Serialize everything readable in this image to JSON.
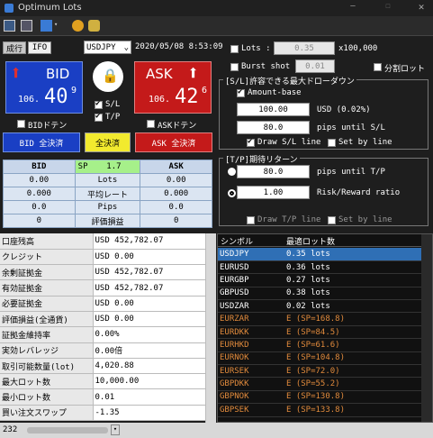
{
  "window": {
    "title": "Optimum Lots"
  },
  "toolbar": {
    "icons": [
      "window-icon",
      "list-icon",
      "grid-icon",
      "person-icon",
      "tools-icon"
    ]
  },
  "mode_tabs": {
    "market": "成行",
    "ifo": "IFO"
  },
  "symbol": {
    "selected": "USDJPY"
  },
  "datetime": "2020/05/08 8:53:09",
  "bid": {
    "label": "BID",
    "price_prefix": "106.",
    "price_big": "40",
    "price_small": "9",
    "color": "#1a3fc4"
  },
  "ask": {
    "label": "ASK",
    "price_prefix": "106.",
    "price_big": "42",
    "price_small": "6",
    "color": "#c41a1a"
  },
  "lock_icon": "lock-icon",
  "sl_label": "S/L",
  "tp_label": "T/P",
  "bid_doten": "BIDドテン",
  "ask_doten": "ASKドテン",
  "close_buttons": {
    "bid": "BID 全決済",
    "all": "全決済",
    "ask": "ASK 全決済"
  },
  "position_grid": {
    "header": {
      "bid": "BID",
      "sp_label": "SP",
      "sp_value": "1.7",
      "ask": "ASK"
    },
    "rows": [
      {
        "bid": "0.00",
        "label": "Lots",
        "ask": "0.00"
      },
      {
        "bid": "0.000",
        "label": "平均レート",
        "ask": "0.000"
      },
      {
        "bid": "0.0",
        "label": "Pips",
        "ask": "0.0"
      },
      {
        "bid": "0",
        "label": "評価損益",
        "ask": "0"
      }
    ]
  },
  "lots_panel": {
    "lots_label": "Lots :",
    "lots_value": "0.35",
    "lots_unit": "x100,000",
    "burst_label": "Burst shot :",
    "burst_value": "0.01",
    "split_label": "分割ロット"
  },
  "sl_panel": {
    "title": "[S/L]許容できる最大ドローダウン",
    "amount_base": "Amount-base",
    "amount_value": "100.00",
    "amount_unit": "USD (0.02%)",
    "pips_value": "80.0",
    "pips_unit": "pips until S/L",
    "draw_sl": "Draw S/L line",
    "set_by_line": "Set by line"
  },
  "tp_panel": {
    "title": "[T/P]期待リターン",
    "pips_value": "80.0",
    "pips_unit": "pips until T/P",
    "ratio_value": "1.00",
    "ratio_unit": "Risk/Reward ratio",
    "draw_tp": "Draw T/P line",
    "set_by_line": "Set by line"
  },
  "account": [
    {
      "k": "口座残高",
      "v": "USD 452,782.07"
    },
    {
      "k": "クレジット",
      "v": "USD 0.00"
    },
    {
      "k": "余剰証拠金",
      "v": "USD 452,782.07"
    },
    {
      "k": "有効証拠金",
      "v": "USD 452,782.07"
    },
    {
      "k": "必要証拠金",
      "v": "USD 0.00"
    },
    {
      "k": "評価損益(全通貨)",
      "v": "USD 0.00"
    },
    {
      "k": "証拠金維持率",
      "v": "0.00%"
    },
    {
      "k": "実効レバレッジ",
      "v": "0.00倍"
    },
    {
      "k": "取引可能数量(lot)",
      "v": "4,020.88"
    },
    {
      "k": "最大ロット数",
      "v": "10,000.00"
    },
    {
      "k": "最小ロット数",
      "v": "0.01"
    },
    {
      "k": "買い注文スワップ",
      "v": "-1.35"
    }
  ],
  "lot_table": {
    "col1": "シンボル",
    "col2": "最適ロット数",
    "rows": [
      {
        "s": "USDJPY",
        "v": "0.35 lots",
        "sel": true
      },
      {
        "s": "EURUSD",
        "v": "0.36 lots"
      },
      {
        "s": "EURGBP",
        "v": "0.27 lots"
      },
      {
        "s": "GBPUSD",
        "v": "0.38 lots"
      },
      {
        "s": "USDZAR",
        "v": "0.02 lots"
      },
      {
        "s": "EURZAR",
        "v": "E (SP=168.8)",
        "warn": true
      },
      {
        "s": "EURDKK",
        "v": "E (SP=84.5)",
        "warn": true
      },
      {
        "s": "EURHKD",
        "v": "E (SP=61.6)",
        "warn": true
      },
      {
        "s": "EURNOK",
        "v": "E (SP=104.8)",
        "warn": true
      },
      {
        "s": "EURSEK",
        "v": "E (SP=72.0)",
        "warn": true
      },
      {
        "s": "GBPDKK",
        "v": "E (SP=55.2)",
        "warn": true
      },
      {
        "s": "GBPNOK",
        "v": "E (SP=130.8)",
        "warn": true
      },
      {
        "s": "GBPSEK",
        "v": "E (SP=133.8)",
        "warn": true
      }
    ]
  },
  "status": {
    "text": "232"
  }
}
